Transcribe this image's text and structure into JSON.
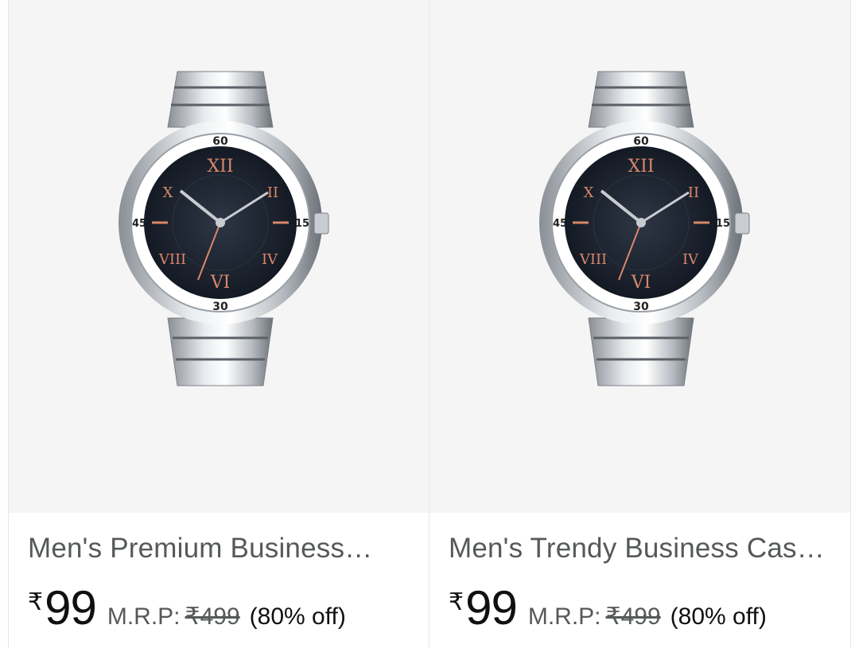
{
  "products": [
    {
      "title": "Men's Premium Business…",
      "currency": "₹",
      "price": "99",
      "mrp_label": "M.R.P:",
      "mrp": "₹499",
      "discount": "(80% off)",
      "image": "silver-steel-watch-dark-dial"
    },
    {
      "title": "Men's Trendy Business Casu…",
      "currency": "₹",
      "price": "99",
      "mrp_label": "M.R.P:",
      "mrp": "₹499",
      "discount": "(80% off)",
      "image": "silver-steel-watch-dark-dial"
    }
  ],
  "colors": {
    "image_bg": "#f5f5f5",
    "title": "#565959",
    "price": "#0f1111",
    "dial": "#1f2633",
    "rose_gold": "#d9876a"
  }
}
